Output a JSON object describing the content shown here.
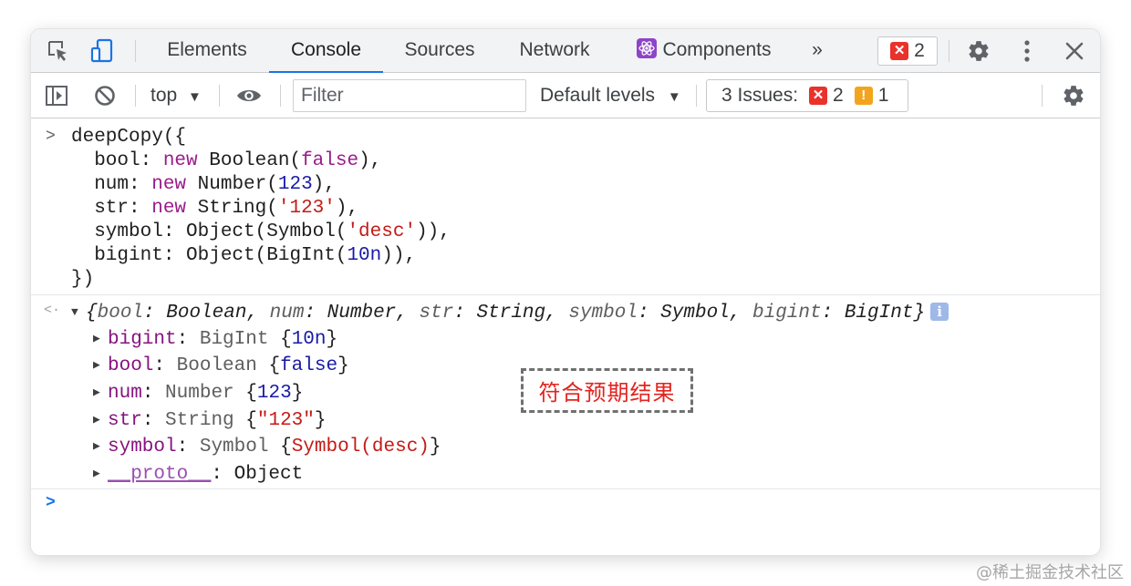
{
  "tabs": [
    {
      "label": "Elements",
      "active": false
    },
    {
      "label": "Console",
      "active": true
    },
    {
      "label": "Sources",
      "active": false
    },
    {
      "label": "Network",
      "active": false
    },
    {
      "label": "Components",
      "active": false
    }
  ],
  "tabbar": {
    "more_tabs_glyph": "»",
    "error_count": "2",
    "icons": [
      "inspect-element-icon",
      "device-toolbar-icon",
      "react-icon",
      "error-icon",
      "settings-icon",
      "kebab-menu-icon",
      "close-icon"
    ]
  },
  "toolbar": {
    "context": "top",
    "filter_placeholder": "Filter",
    "levels": "Default levels",
    "issues_label": "3 Issues:",
    "issues_errors": "2",
    "issues_warnings": "1",
    "icons": [
      "sidebar-toggle-icon",
      "clear-console-icon",
      "dropdown-caret-icon",
      "live-expression-eye-icon",
      "settings-icon"
    ]
  },
  "console": {
    "input_prompt": ">",
    "result_prompt": "<·",
    "input_lines": [
      "deepCopy({",
      "  bool: new Boolean(false),",
      "  num: new Number(123),",
      "  str: new String('123'),",
      "  symbol: Object(Symbol('desc')),",
      "  bigint: Object(BigInt(10n)),",
      "})"
    ],
    "result_summary": "{bool: Boolean, num: Number, str: String, symbol: Symbol, bigint: BigInt}",
    "result_props": [
      {
        "key": "bigint",
        "type": "BigInt",
        "value": "{10n}"
      },
      {
        "key": "bool",
        "type": "Boolean",
        "value": "{false}"
      },
      {
        "key": "num",
        "type": "Number",
        "value": "{123}"
      },
      {
        "key": "str",
        "type": "String",
        "value": "{\"123\"}"
      },
      {
        "key": "symbol",
        "type": "Symbol",
        "value": "{Symbol(desc)}"
      },
      {
        "key": "__proto__",
        "type": "",
        "value": "Object"
      }
    ],
    "annotation": "符合预期结果",
    "empty_prompt": ">"
  },
  "watermark": "@稀土掘金技术社区",
  "colors": {
    "accent": "#1a73e8",
    "keyword": "#9a1b8b",
    "number": "#1a1aa6",
    "string": "#c41a16",
    "property": "#881280",
    "error": "#e8322b",
    "warning": "#f2a51c",
    "annotation_text": "#e2241f"
  }
}
